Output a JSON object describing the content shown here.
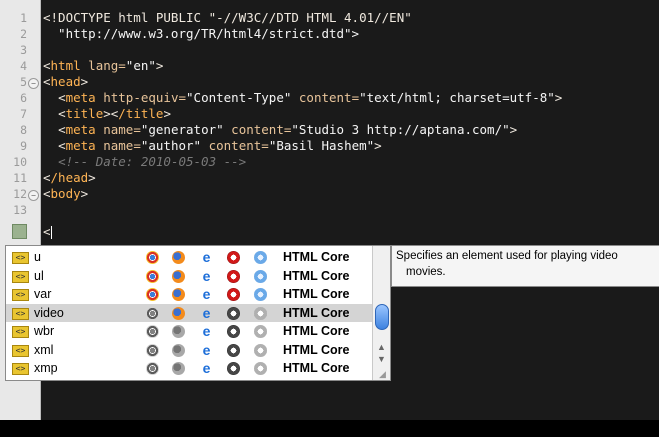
{
  "gutter": {
    "lines": [
      "1",
      "2",
      "3",
      "4",
      "5",
      "6",
      "7",
      "8",
      "9",
      "10",
      "11",
      "12",
      "13"
    ]
  },
  "code": {
    "l1": "<!DOCTYPE html PUBLIC \"-//W3C//DTD HTML 4.01//EN\"",
    "l2": "  \"http://www.w3.org/TR/html4/strict.dtd\">",
    "l4_open": "<",
    "l4_tag": "html",
    "l4_attr": " lang=",
    "l4_val": "\"en\"",
    "l4_close": ">",
    "l5_open": "<",
    "l5_tag": "head",
    "l5_close": ">",
    "l6_tag": "meta",
    "l6_attr1": " http-equiv=",
    "l6_val1": "\"Content-Type\"",
    "l6_attr2": " content=",
    "l6_val2": "\"text/html; charset=utf-8\"",
    "l7_tag": "title",
    "l7_close_tag": "/title",
    "l8_tag": "meta",
    "l8_attr1": " name=",
    "l8_val1": "\"generator\"",
    "l8_attr2": " content=",
    "l8_val2": "\"Studio 3 http://aptana.com/\"",
    "l9_tag": "meta",
    "l9_attr1": " name=",
    "l9_val1": "\"author\"",
    "l9_attr2": " content=",
    "l9_val2": "\"Basil Hashem\"",
    "l10": "<!-- Date: 2010-05-03 -->",
    "l11_tag": "/head",
    "l12_tag": "body",
    "l14_text": "<"
  },
  "autocomplete": {
    "items": [
      {
        "name": "u",
        "library": "HTML Core"
      },
      {
        "name": "ul",
        "library": "HTML Core"
      },
      {
        "name": "var",
        "library": "HTML Core"
      },
      {
        "name": "video",
        "library": "HTML Core"
      },
      {
        "name": "wbr",
        "library": "HTML Core"
      },
      {
        "name": "xml",
        "library": "HTML Core"
      },
      {
        "name": "xmp",
        "library": "HTML Core"
      }
    ],
    "selected": "video"
  },
  "tooltip": {
    "line1": "Specifies an element used for playing video",
    "line2": "movies."
  },
  "icons": {
    "tag": "html-tag-icon",
    "ie_glyph": "e",
    "scroll_up": "▲",
    "scroll_down": "▼",
    "resize": "◢"
  }
}
